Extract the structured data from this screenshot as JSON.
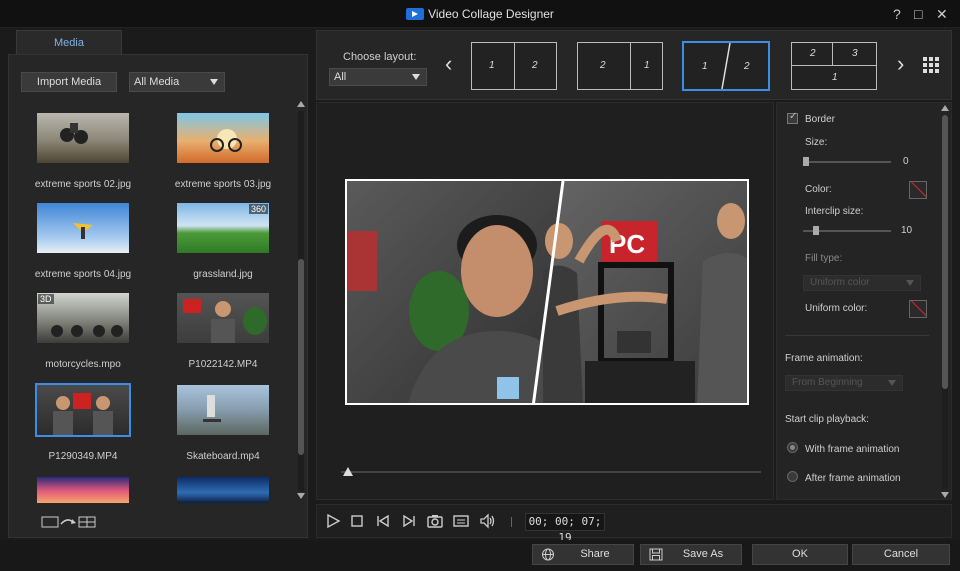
{
  "window": {
    "title": "Video Collage Designer",
    "help": "?",
    "maximize": "□",
    "close": "✕"
  },
  "media_panel": {
    "tab_label": "Media",
    "import_label": "Import Media",
    "filter_value": "All Media",
    "items": [
      {
        "label": "extreme sports 02.jpg",
        "badge": ""
      },
      {
        "label": "extreme sports 03.jpg",
        "badge": ""
      },
      {
        "label": "extreme sports 04.jpg",
        "badge": ""
      },
      {
        "label": "grassland.jpg",
        "badge": "360"
      },
      {
        "label": "motorcycles.mpo",
        "badge": "3D"
      },
      {
        "label": "P1022142.MP4",
        "badge": ""
      },
      {
        "label": "P1290349.MP4",
        "badge": ""
      },
      {
        "label": "Skateboard.mp4",
        "badge": ""
      }
    ]
  },
  "layout_strip": {
    "label": "Choose layout:",
    "select_value": "All",
    "prev": "‹",
    "next": "›",
    "layouts": [
      {
        "cells": [
          "1",
          "2"
        ]
      },
      {
        "cells": [
          "2",
          "1"
        ]
      },
      {
        "cells": [
          "1",
          "2"
        ]
      },
      {
        "cells": [
          "2",
          "3",
          "1"
        ]
      }
    ]
  },
  "settings": {
    "border_label": "Border",
    "size_label": "Size:",
    "size_value": "0",
    "color_label": "Color:",
    "interclip_label": "Interclip size:",
    "interclip_value": "10",
    "fill_type_label": "Fill type:",
    "fill_type_value": "Uniform color",
    "uniform_color_label": "Uniform color:",
    "frame_animation_label": "Frame animation:",
    "frame_animation_value": "From Beginning",
    "start_playback_label": "Start clip playback:",
    "with_frame_label": "With frame animation",
    "after_frame_label": "After frame animation"
  },
  "playback": {
    "timecode": "00; 00; 07; 19"
  },
  "footer": {
    "share": "Share",
    "save_as": "Save As",
    "ok": "OK",
    "cancel": "Cancel"
  },
  "colors": {
    "accent": "#3b8ee8",
    "border_color": "#d22233"
  }
}
